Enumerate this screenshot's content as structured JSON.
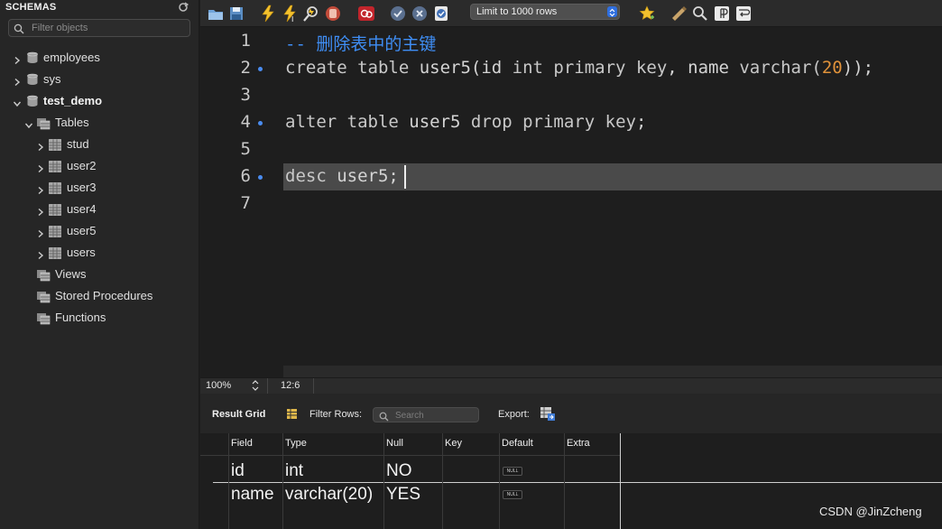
{
  "sidebar": {
    "title": "SCHEMAS",
    "filter_placeholder": "Filter objects",
    "items": [
      {
        "label": "employees"
      },
      {
        "label": "sys"
      },
      {
        "label": "test_demo"
      },
      {
        "label": "Tables"
      },
      {
        "label": "stud"
      },
      {
        "label": "user2"
      },
      {
        "label": "user3"
      },
      {
        "label": "user4"
      },
      {
        "label": "user5"
      },
      {
        "label": "users"
      },
      {
        "label": "Views"
      },
      {
        "label": "Stored Procedures"
      },
      {
        "label": "Functions"
      }
    ]
  },
  "toolbar": {
    "limit_label": "Limit to 1000 rows",
    "icons": [
      "open-folder-icon",
      "save-icon",
      "execute-icon",
      "execute-current-icon",
      "explain-icon",
      "stop-icon",
      "toggle-error-icon",
      "commit-icon",
      "rollback-icon",
      "autocommit-icon",
      "bookmark-star-icon",
      "beautify-icon",
      "find-icon",
      "invisible-chars-icon",
      "wrap-icon"
    ]
  },
  "editor": {
    "line_numbers": [
      "1",
      "2",
      "3",
      "4",
      "5",
      "6",
      "7"
    ],
    "lines": {
      "l1": "-- 删除表中的主键",
      "l2a": "create table ",
      "l2b": "user5(id ",
      "l2c": "int primary key",
      "l2d": ", name ",
      "l2e": "varchar(",
      "l2f": "20",
      "l2g": "));",
      "l4a": "alter table ",
      "l4b": "user5 ",
      "l4c": "drop primary key",
      "l4d": ";",
      "l6a": "desc ",
      "l6b": "user5;"
    }
  },
  "statusbar": {
    "zoom": "100%",
    "cursor_pos": "12:6"
  },
  "results": {
    "result_grid_label": "Result Grid",
    "filter_rows_label": "Filter Rows:",
    "search_placeholder": "Search",
    "export_label": "Export:",
    "columns": [
      "Field",
      "Type",
      "Null",
      "Key",
      "Default",
      "Extra"
    ],
    "rows": [
      {
        "field": "id",
        "type": "int",
        "null": "NO",
        "key": "",
        "default": "NULL",
        "extra": ""
      },
      {
        "field": "name",
        "type": "varchar(20)",
        "null": "YES",
        "key": "",
        "default": "NULL",
        "extra": ""
      }
    ]
  },
  "watermark": "CSDN @JinZcheng",
  "colors": {
    "comment": "#3f8ef5",
    "number": "#e0923a",
    "marker": "#4a8cf0",
    "background": "#1e1e1e"
  }
}
